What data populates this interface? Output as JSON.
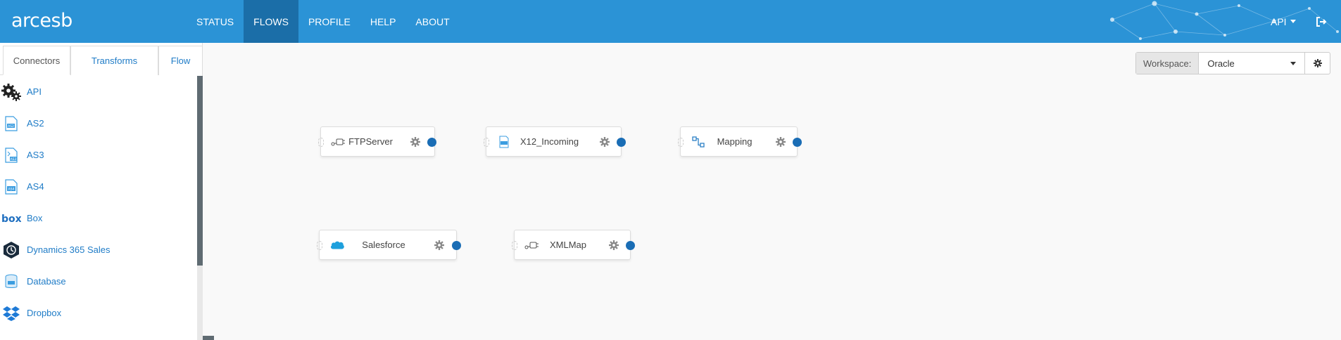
{
  "app": {
    "logo": "arcesb"
  },
  "nav": [
    {
      "label": "STATUS",
      "active": false
    },
    {
      "label": "FLOWS",
      "active": true
    },
    {
      "label": "PROFILE",
      "active": false
    },
    {
      "label": "HELP",
      "active": false
    },
    {
      "label": "ABOUT",
      "active": false
    }
  ],
  "user": {
    "label": "API"
  },
  "sidebar": {
    "tabs": [
      "Connectors",
      "Transforms",
      "Flow"
    ],
    "connectors": [
      {
        "label": "API",
        "icon": "gears-icon"
      },
      {
        "label": "AS2",
        "icon": "as2-icon"
      },
      {
        "label": "AS3",
        "icon": "as3-icon"
      },
      {
        "label": "AS4",
        "icon": "as4-icon"
      },
      {
        "label": "Box",
        "icon": "box-logo-icon"
      },
      {
        "label": "Dynamics 365 Sales",
        "icon": "dynamics-icon"
      },
      {
        "label": "Database",
        "icon": "database-icon"
      },
      {
        "label": "Dropbox",
        "icon": "dropbox-icon"
      }
    ]
  },
  "workspace": {
    "label": "Workspace:",
    "selected": "Oracle"
  },
  "flow_nodes": [
    {
      "label": "FTPServer",
      "icon": "connector-icon"
    },
    {
      "label": "X12_Incoming",
      "icon": "edi-icon"
    },
    {
      "label": "Mapping",
      "icon": "mapping-icon"
    },
    {
      "label": "Salesforce",
      "icon": "salesforce-icon"
    },
    {
      "label": "XMLMap",
      "icon": "connector-icon"
    }
  ],
  "colors": {
    "header": "#2b93d6",
    "nav_active": "#1b6ea8",
    "link": "#1f7cc7",
    "port": "#1a6db5"
  }
}
